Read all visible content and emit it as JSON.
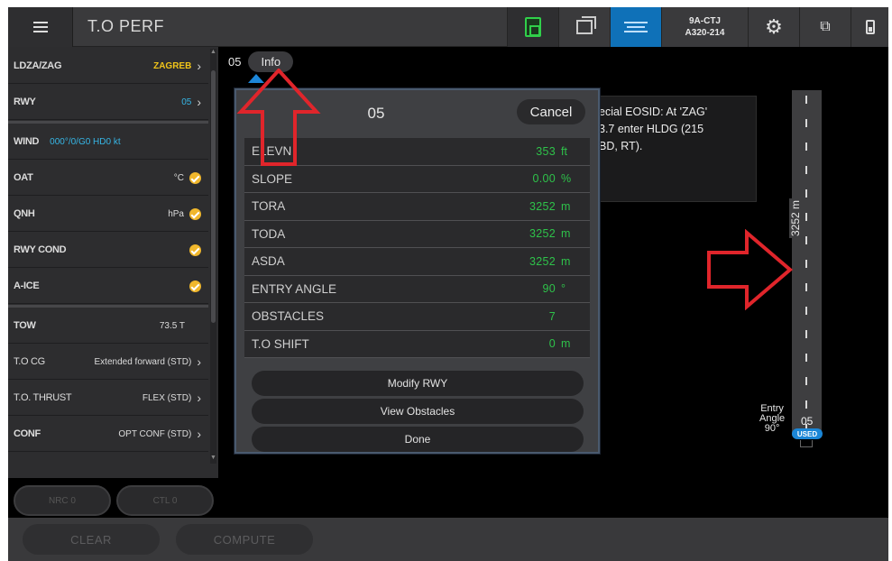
{
  "header": {
    "title": "T.O PERF",
    "aircraft_reg": "9A-CTJ",
    "aircraft_type": "A320-214"
  },
  "left_panel": {
    "rows": {
      "airport": {
        "label": "LDZA/ZAG",
        "value": "ZAGREB"
      },
      "rwy": {
        "label": "RWY",
        "value": "05"
      },
      "wind": {
        "label": "WIND",
        "value": "000°/0/G0 HD0 kt"
      },
      "oat": {
        "label": "OAT",
        "value": "°C"
      },
      "qnh": {
        "label": "QNH",
        "value": "hPa"
      },
      "rwy_cond": {
        "label": "RWY COND"
      },
      "a_ice": {
        "label": "A-ICE"
      },
      "tow": {
        "label": "TOW",
        "value": "73.5 T"
      },
      "to_cg": {
        "label": "T.O CG",
        "value": "Extended forward (STD)"
      },
      "to_thrust": {
        "label": "T.O. THRUST",
        "value": "FLEX (STD)"
      },
      "conf": {
        "label": "CONF",
        "value": "OPT CONF (STD)"
      }
    },
    "ghost_buttons": {
      "left": "NRC 0",
      "right": "CTL 0"
    }
  },
  "bottom_bar": {
    "clear_label": "CLEAR",
    "compute_label": "COMPUTE"
  },
  "tabs": {
    "runway": "05",
    "info": "Info"
  },
  "eosid": {
    "line1": "ecial EOSID: At 'ZAG'",
    "line2": "3.7 enter HLDG (215",
    "line3": "BD, RT)."
  },
  "modal": {
    "title": "05",
    "cancel_label": "Cancel",
    "rows": [
      {
        "label": "ELEVN",
        "value": "353",
        "unit": "ft"
      },
      {
        "label": "SLOPE",
        "value": "0.00",
        "unit": "%"
      },
      {
        "label": "TORA",
        "value": "3252",
        "unit": "m"
      },
      {
        "label": "TODA",
        "value": "3252",
        "unit": "m"
      },
      {
        "label": "ASDA",
        "value": "3252",
        "unit": "m"
      },
      {
        "label": "ENTRY ANGLE",
        "value": "90",
        "unit": "°"
      },
      {
        "label": "OBSTACLES",
        "value": "7",
        "unit": ""
      },
      {
        "label": "T.O SHIFT",
        "value": "0",
        "unit": "m"
      }
    ],
    "modify_label": "Modify RWY",
    "view_obstacles_label": "View Obstacles",
    "done_label": "Done"
  },
  "runway_graphic": {
    "length": "3252 m",
    "entry_line1": "Entry",
    "entry_line2": "Angle",
    "entry_line3": "90°",
    "rwy_label": "05",
    "used_badge": "USED"
  },
  "colors": {
    "accent_blue": "#1c86d9",
    "value_green": "#2ec24a",
    "warning_amber": "#f0b72c",
    "annotation_red": "#e0252b"
  }
}
